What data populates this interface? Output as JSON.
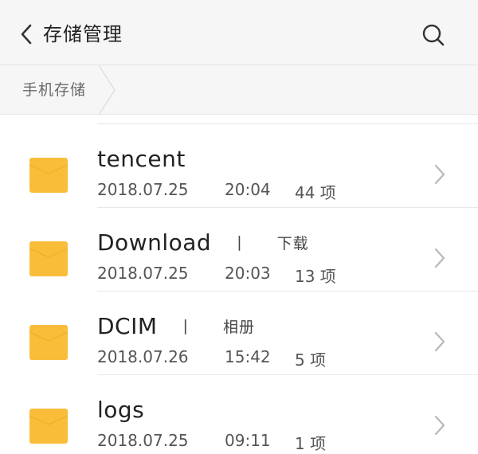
{
  "header": {
    "title": "存储管理",
    "back_icon": "chevron-left-icon",
    "search_icon": "search-icon"
  },
  "breadcrumb": {
    "items": [
      {
        "label": "手机存储"
      }
    ]
  },
  "colors": {
    "folder": "#f9bd3a",
    "folder_flap": "#f2ae22",
    "header_bg": "#f6f6f6",
    "chevron": "#b8b8b8"
  },
  "files": [
    {
      "name": "tencent",
      "separator": "",
      "alias": "",
      "date": "2018.07.25",
      "time": "20:04",
      "count": "44 项",
      "icon": "folder-icon"
    },
    {
      "name": "Download",
      "separator": "|",
      "alias": "下载",
      "date": "2018.07.25",
      "time": "20:03",
      "count": "13 项",
      "icon": "folder-icon"
    },
    {
      "name": "DCIM",
      "separator": "|",
      "alias": "相册",
      "date": "2018.07.26",
      "time": "15:42",
      "count": "5 项",
      "icon": "folder-icon"
    },
    {
      "name": "logs",
      "separator": "",
      "alias": "",
      "date": "2018.07.25",
      "time": "09:11",
      "count": "1 项",
      "icon": "folder-icon"
    }
  ]
}
